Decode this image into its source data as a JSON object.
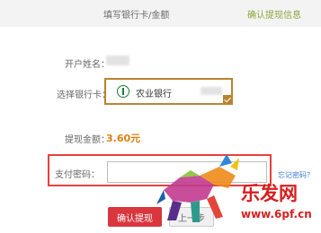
{
  "header": {
    "step_current": "填写银行卡/金额",
    "step_next": "确认提现信息"
  },
  "form": {
    "account_name_label": "开户姓名：",
    "bank_card_label": "选择银行卡：",
    "bank_name": "农业银行",
    "amount_label": "提现金额：",
    "amount_value": "3.60元",
    "password_label": "支付密码：",
    "password_value": "",
    "forgot_password_link": "忘记密码？"
  },
  "actions": {
    "confirm_button": "确认提现",
    "other_button": "上一步"
  },
  "watermark": {
    "title": "乐发网",
    "url": "www.6pf.cn"
  },
  "colors": {
    "accent_red": "#d9363e",
    "amount_orange": "#e07e10",
    "step_green": "#8aa83c",
    "bank_border": "#b8842f",
    "highlight_red": "#e94040"
  }
}
